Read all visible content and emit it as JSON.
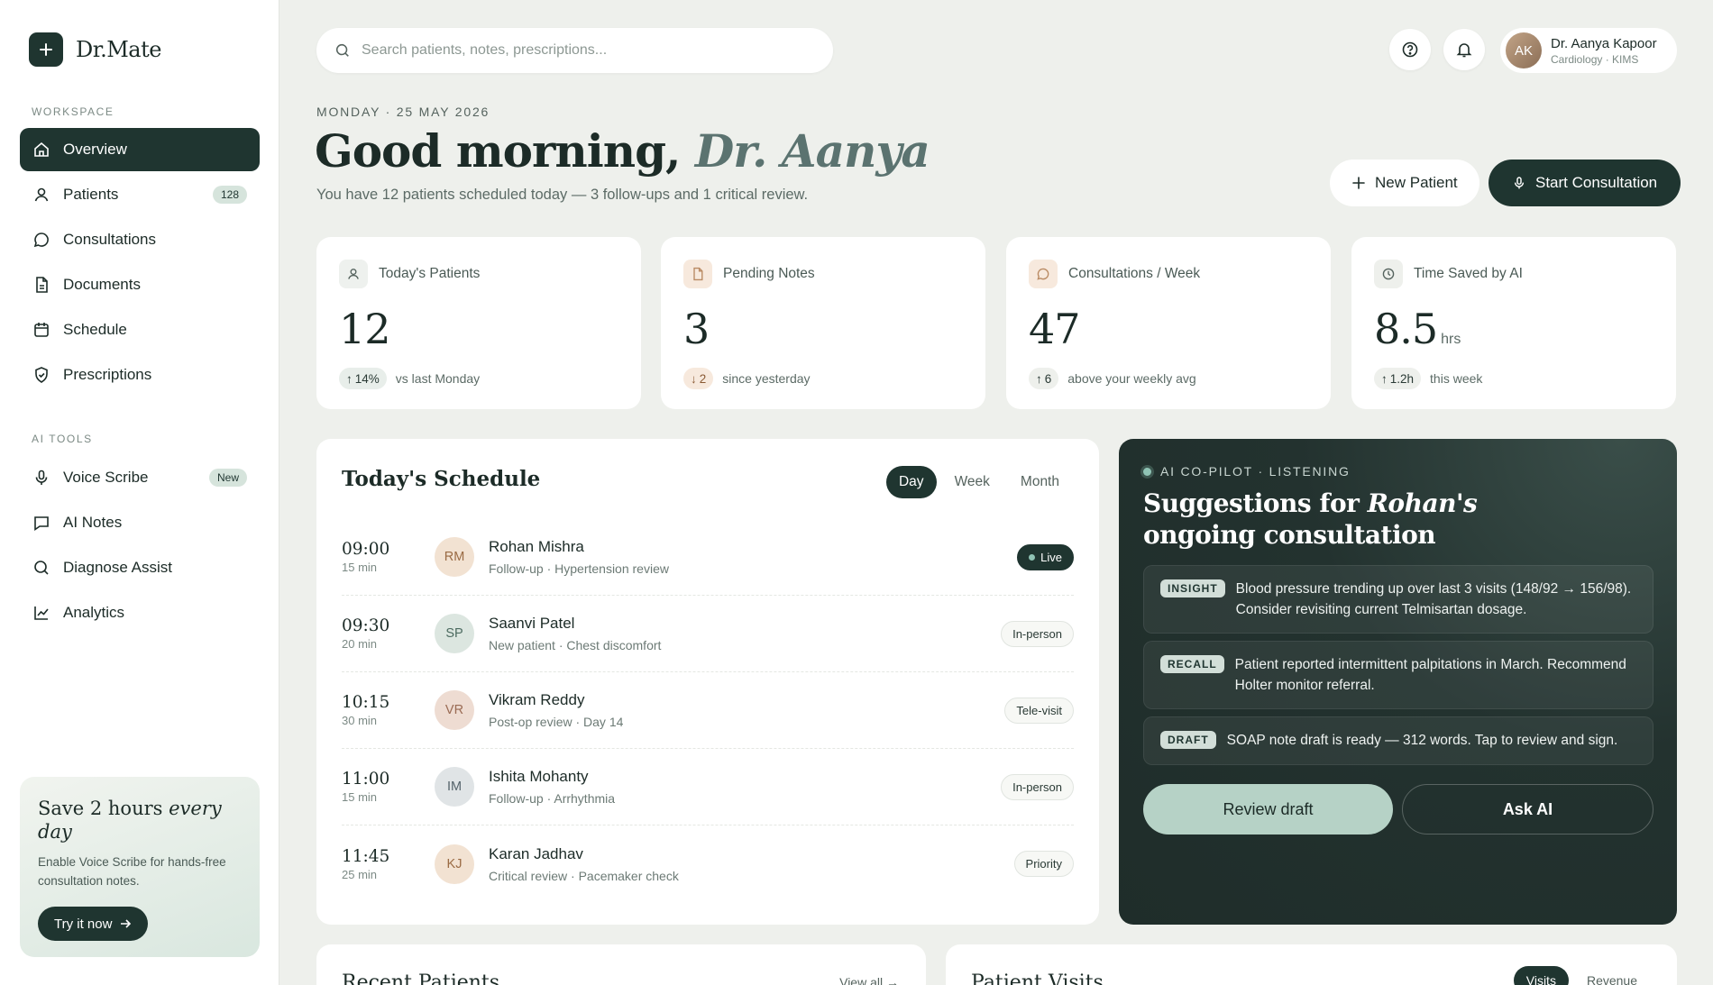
{
  "app": {
    "name": "Dr.Mate"
  },
  "sidebar": {
    "workspace_label": "WORKSPACE",
    "ai_tools_label": "AI TOOLS",
    "workspace_items": [
      {
        "label": "Overview",
        "icon": "home-icon"
      },
      {
        "label": "Patients",
        "icon": "user-icon",
        "badge": "128"
      },
      {
        "label": "Consultations",
        "icon": "chat-icon"
      },
      {
        "label": "Documents",
        "icon": "document-icon"
      },
      {
        "label": "Schedule",
        "icon": "calendar-icon"
      },
      {
        "label": "Prescriptions",
        "icon": "shield-icon"
      }
    ],
    "ai_items": [
      {
        "label": "Voice Scribe",
        "icon": "mic-icon",
        "badge": "New"
      },
      {
        "label": "AI Notes",
        "icon": "note-icon"
      },
      {
        "label": "Diagnose Assist",
        "icon": "search-icon"
      },
      {
        "label": "Analytics",
        "icon": "chart-icon"
      }
    ],
    "promo": {
      "title_prefix": "Save 2 hours ",
      "title_em": "every day",
      "text": "Enable Voice Scribe for hands-free consultation notes.",
      "button": "Try it now"
    }
  },
  "topbar": {
    "search_placeholder": "Search patients, notes, prescriptions...",
    "user": {
      "initials": "AK",
      "name": "Dr. Aanya Kapoor",
      "role": "Cardiology · KIMS"
    }
  },
  "header": {
    "date": "MONDAY · 25 MAY 2026",
    "greeting_prefix": "Good morning, ",
    "greeting_name": "Dr. Aanya",
    "subline": "You have 12 patients scheduled today — 3 follow-ups and 1 critical review.",
    "new_patient": "New Patient",
    "start_consultation": "Start Consultation"
  },
  "stats": [
    {
      "label": "Today's Patients",
      "value": "12",
      "unit": "",
      "delta": "14%",
      "direction": "up",
      "note": "vs last Monday"
    },
    {
      "label": "Pending Notes",
      "value": "3",
      "unit": "",
      "delta": "2",
      "direction": "down",
      "note": "since yesterday"
    },
    {
      "label": "Consultations / Week",
      "value": "47",
      "unit": "",
      "delta": "6",
      "direction": "up",
      "note": "above your weekly avg"
    },
    {
      "label": "Time Saved by AI",
      "value": "8.5",
      "unit": "hrs",
      "delta": "1.2h",
      "direction": "up",
      "note": "this week"
    }
  ],
  "schedule": {
    "title": "Today's Schedule",
    "tabs": [
      "Day",
      "Week",
      "Month"
    ],
    "active_tab": "Day",
    "rows": [
      {
        "time": "09:00",
        "duration": "15 min",
        "initials": "RM",
        "name": "Rohan Mishra",
        "detail": "Follow-up · Hypertension review",
        "status": "Live"
      },
      {
        "time": "09:30",
        "duration": "20 min",
        "initials": "SP",
        "name": "Saanvi Patel",
        "detail": "New patient · Chest discomfort",
        "status": "In-person"
      },
      {
        "time": "10:15",
        "duration": "30 min",
        "initials": "VR",
        "name": "Vikram Reddy",
        "detail": "Post-op review · Day 14",
        "status": "Tele-visit"
      },
      {
        "time": "11:00",
        "duration": "15 min",
        "initials": "IM",
        "name": "Ishita Mohanty",
        "detail": "Follow-up · Arrhythmia",
        "status": "In-person"
      },
      {
        "time": "11:45",
        "duration": "25 min",
        "initials": "KJ",
        "name": "Karan Jadhav",
        "detail": "Critical review · Pacemaker check",
        "status": "Priority"
      }
    ]
  },
  "copilot": {
    "tag": "AI CO-PILOT · LISTENING",
    "title_prefix": "Suggestions for ",
    "title_em": "Rohan's",
    "title_suffix": " ongoing consultation",
    "insights": [
      {
        "tag": "INSIGHT",
        "text": "Blood pressure trending up over last 3 visits (148/92 → 156/98). Consider revisiting current Telmisartan dosage."
      },
      {
        "tag": "RECALL",
        "text": "Patient reported intermittent palpitations in March. Recommend Holter monitor referral."
      },
      {
        "tag": "DRAFT",
        "text": "SOAP note draft is ready — 312 words. Tap to review and sign."
      }
    ],
    "review_button": "Review draft",
    "ask_button": "Ask AI"
  },
  "bottom": {
    "recent_title": "Recent Patients",
    "recent_link": "View all →",
    "visits_title": "Patient Visits",
    "visits_tabs": [
      "Visits",
      "Revenue"
    ]
  },
  "colors": {
    "primary": "#1f3530",
    "accent": "#8fc3b4",
    "background": "#eef0ec"
  }
}
